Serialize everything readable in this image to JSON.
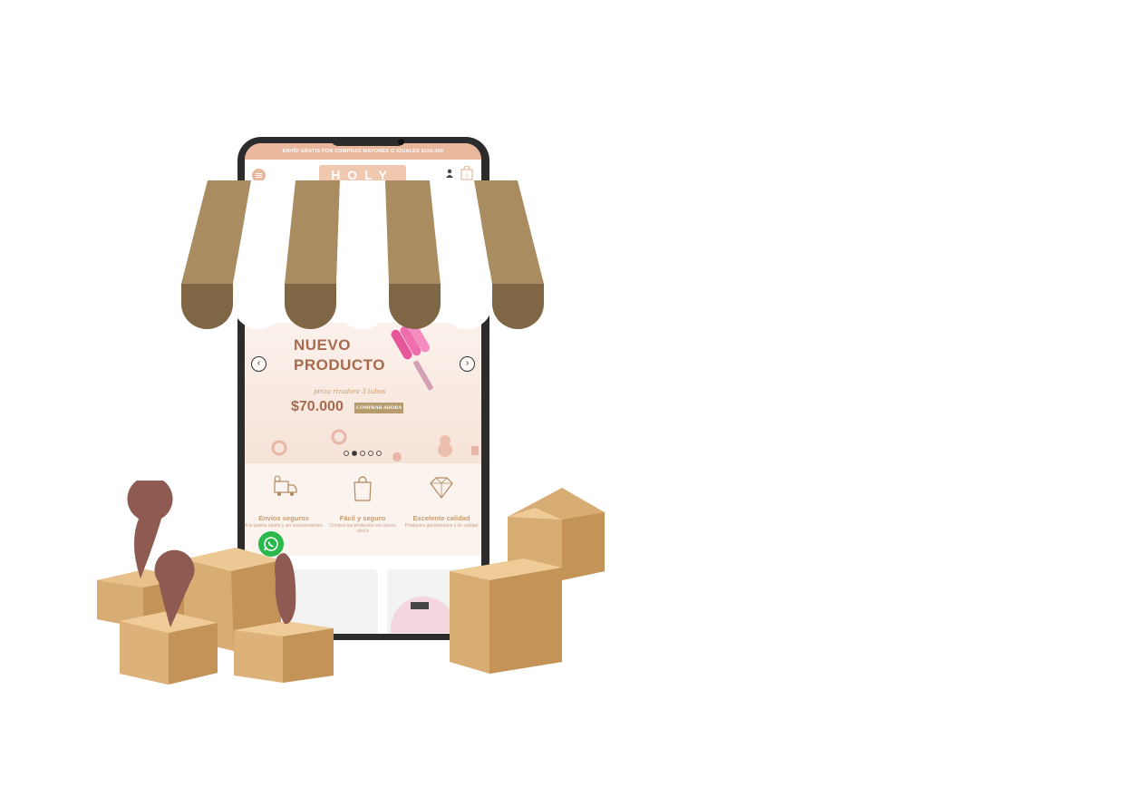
{
  "store": {
    "topbar_text": "ENVÍO GRATIS POR COMPRAS MAYORES O IGUALES $100.000",
    "logo_text": "HOLY",
    "cart_count": "0"
  },
  "banner": {
    "title_line1": "NUEVO",
    "title_line2": "PRODUCTO",
    "subtitle": "pinza rizadora 3 tubos",
    "price": "$70.000",
    "button_label": "COMPRAR AHORA",
    "slide_count": 5,
    "active_slide": 2
  },
  "features": [
    {
      "title": "Envíos seguros",
      "desc": "A tu puerta rápido y sin inconvenientes",
      "icon": "delivery-truck-icon"
    },
    {
      "title": "Fácil y seguro",
      "desc": "Compra tus productos con pocos click's",
      "icon": "shopping-bag-icon"
    },
    {
      "title": "Excelente calidad",
      "desc": "Productos garantizados y de calidad",
      "icon": "diamond-icon"
    }
  ],
  "colors": {
    "accent": "#e8b79c",
    "gold": "#c79b6c",
    "awning_brown": "#a98c60",
    "box": "#d2a770",
    "pin": "#8e5a52",
    "whatsapp": "#29b94b"
  }
}
